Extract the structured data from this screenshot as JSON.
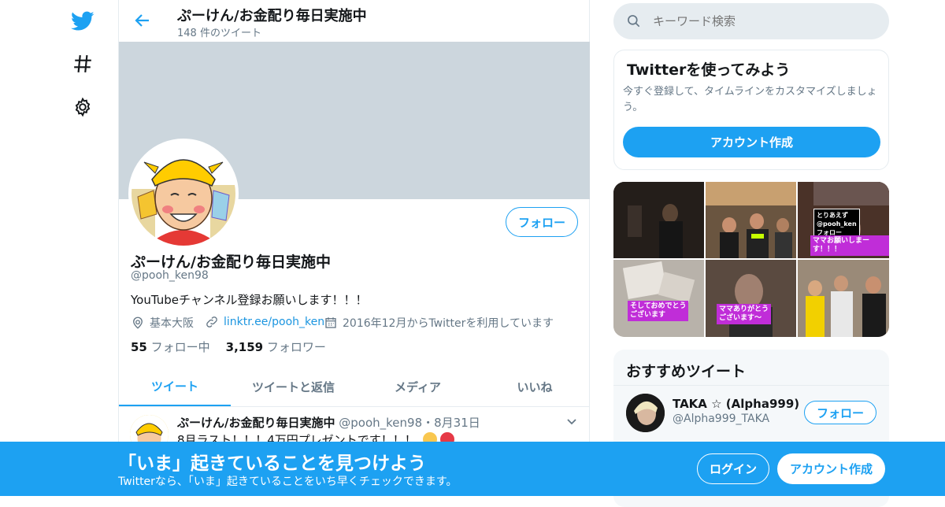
{
  "nav": {
    "logo_icon": "twitter-bird-icon",
    "explore_icon": "hashtag-icon",
    "settings_icon": "gear-icon"
  },
  "header": {
    "title": "ぷーけん/お金配り毎日実施中",
    "tweet_count": "148 件のツイート"
  },
  "profile": {
    "name": "ぷーけん/お金配り毎日実施中",
    "handle": "@pooh_ken98",
    "bio": "YouTubeチャンネル登録お願いします！！！",
    "location": "基本大阪",
    "link": "linktr.ee/pooh_ken",
    "joined": "2016年12月からTwitterを利用しています",
    "following_count": "55",
    "following_label": "フォロー中",
    "followers_count": "3,159",
    "followers_label": "フォロワー",
    "follow_label": "フォロー"
  },
  "tabs": [
    "ツイート",
    "ツイートと返信",
    "メディア",
    "いいね"
  ],
  "tweet": {
    "name": "ぷーけん/お金配り毎日実施中",
    "handle": "@pooh_ken98",
    "sep": "・",
    "date": "8月31日",
    "text": "8月ラスト！！！4万円プレゼントです！！！"
  },
  "search": {
    "placeholder": "キーワード検索"
  },
  "signup_card": {
    "title": "Twitterを使ってみよう",
    "desc": "今すぐ登録して、タイムラインをカスタマイズしましょう。",
    "button": "アカウント作成"
  },
  "media_stickers": {
    "s1": "とりあえず",
    "s2": "@pooh_ken",
    "s3": "フォロー",
    "s4": "ママお願いしまーす！！！",
    "s5": "そしておめでとう",
    "s6": "ございます",
    "s7": "ママありがとう",
    "s8": "ございます～"
  },
  "recommended": {
    "title": "おすすめツイート",
    "name": "TAKA ☆ (Alpha999)",
    "handle": "@Alpha999_TAKA",
    "follow_label": "フォロー"
  },
  "bottom_bar": {
    "title": "「いま」起きていることを見つけよう",
    "subtitle": "Twitterなら、「いま」起きていることをいち早くチェックできます。",
    "login": "ログイン",
    "signup": "アカウント作成"
  },
  "colors": {
    "accent": "#1da1f2",
    "banner": "#ccd6dd",
    "muted": "#657786",
    "border": "#e6ecf0"
  }
}
